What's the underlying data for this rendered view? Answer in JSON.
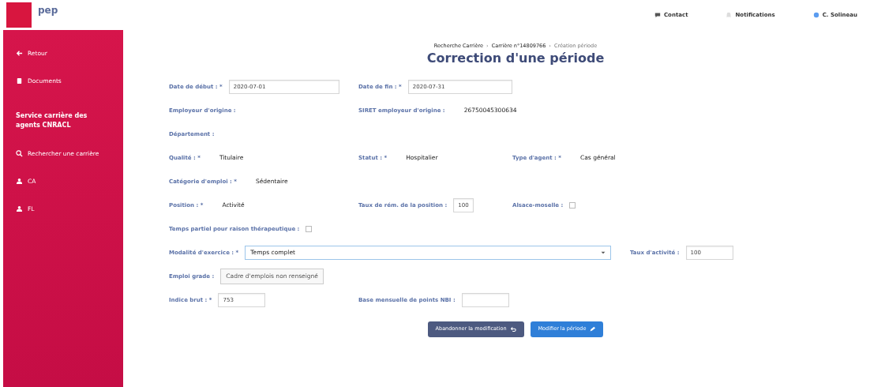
{
  "header": {
    "app_name": "pep",
    "links": [
      {
        "kind": "contact",
        "label": "Contact"
      },
      {
        "kind": "notifications",
        "label": "Notifications"
      },
      {
        "kind": "user",
        "label": "C. Solineau"
      }
    ]
  },
  "sidebar": {
    "items": [
      {
        "kind": "back",
        "label": "Retour"
      },
      {
        "kind": "documents",
        "label": "Documents"
      },
      {
        "kind": "section",
        "label": "Service carrière des agents CNRACL"
      },
      {
        "kind": "search",
        "label": "Rechercher une carrière"
      },
      {
        "kind": "person",
        "label": "CA"
      },
      {
        "kind": "person",
        "label": "FL"
      }
    ]
  },
  "breadcrumb": [
    {
      "kind": "link",
      "label": "Recherche Carrière"
    },
    {
      "kind": "separator",
      "label": "›"
    },
    {
      "kind": "link",
      "label": "Carrière n°14809766"
    },
    {
      "kind": "separator",
      "label": "›"
    },
    {
      "kind": "current",
      "label": "Création période"
    }
  ],
  "title": "Correction d'une période",
  "rows": [
    [
      {
        "kind": "input",
        "label": "Date de début : *",
        "value": "2020-07-01"
      },
      {
        "kind": "input",
        "label": "Date de fin : *",
        "value": "2020-07-31"
      }
    ],
    [
      {
        "kind": "text",
        "label": "Employeur d'origine :"
      },
      {
        "kind": "text",
        "label": "SIRET employeur d'origine :",
        "value": "26750045300634"
      }
    ],
    [
      {
        "kind": "text",
        "label": "Département :"
      }
    ],
    [
      {
        "kind": "text",
        "label": "Qualité : *",
        "value": "Titulaire"
      },
      {
        "kind": "text",
        "label": "Statut : *",
        "value": "Hospitalier"
      },
      {
        "kind": "text",
        "label": "Type d'agent : *",
        "value": "Cas général"
      }
    ],
    [
      {
        "kind": "text",
        "label": "Catégorie d'emploi : *",
        "value": "Sédentaire"
      }
    ],
    [
      {
        "kind": "text",
        "label": "Position : *",
        "value": "Activité"
      },
      {
        "kind": "input",
        "label": "Taux de rém. de la position :",
        "value": "100"
      },
      {
        "kind": "checkbox",
        "label": "Alsace-moselle :",
        "checked": false
      }
    ],
    [
      {
        "kind": "checkbox",
        "label": "Temps partiel pour raison thérapeutique :",
        "checked": false
      }
    ],
    [
      {
        "kind": "select",
        "label": "Modalité d'exercice : *",
        "value": "Temps complet"
      },
      {
        "kind": "input",
        "label": "Taux d'activité :",
        "value": "100"
      }
    ],
    [
      {
        "kind": "button",
        "label": "Emploi grade :",
        "value": "Cadre d'emplois non renseigné"
      }
    ],
    [
      {
        "kind": "input",
        "label": "Indice brut : *",
        "value": "753"
      },
      {
        "kind": "input",
        "label": "Base mensuelle de points NBI :"
      }
    ]
  ],
  "buttons": [
    {
      "kind": "cancel",
      "label": "Abandonner la modification"
    },
    {
      "kind": "submit",
      "label": "Modifier la période"
    }
  ]
}
